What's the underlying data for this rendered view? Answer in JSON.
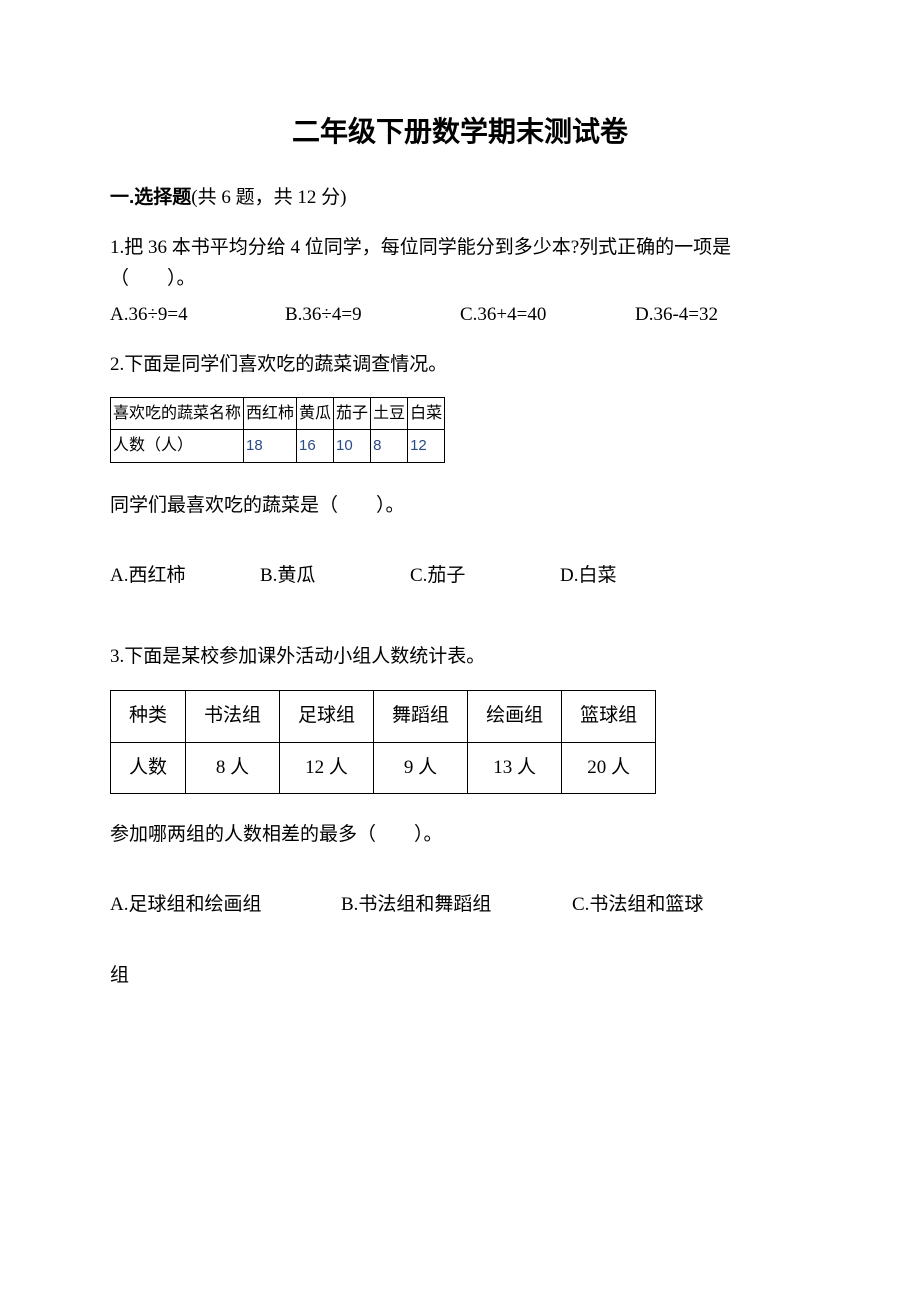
{
  "title": "二年级下册数学期末测试卷",
  "section1": {
    "number": "一.",
    "name": "选择题",
    "info": "(共 6 题，共 12 分)"
  },
  "q1": {
    "text": "1.把 36 本书平均分给 4 位同学，每位同学能分到多少本?列式正确的一项是（　　）。",
    "a": "A.36÷9=4",
    "b": "B.36÷4=9",
    "c": "C.36+4=40",
    "d": "D.36-4=32"
  },
  "q2": {
    "text": "2.下面是同学们喜欢吃的蔬菜调查情况。",
    "table_head": "喜欢吃的蔬菜名称",
    "col1": "西红柿",
    "col2": "黄瓜",
    "col3": "茄子",
    "col4": "土豆",
    "col5": "白菜",
    "row_label": "人数（人）",
    "v1": "18",
    "v2": "16",
    "v3": "10",
    "v4": "8",
    "v5": "12",
    "prompt": "同学们最喜欢吃的蔬菜是（　　）。",
    "a": "A.西红柿",
    "b": "B.黄瓜",
    "c": "C.茄子",
    "d": "D.白菜"
  },
  "q3": {
    "text": "3.下面是某校参加课外活动小组人数统计表。",
    "h1": "种类",
    "h2": "书法组",
    "h3": "足球组",
    "h4": "舞蹈组",
    "h5": "绘画组",
    "h6": "篮球组",
    "r1": "人数",
    "v1": "8 人",
    "v2": "12 人",
    "v3": "9 人",
    "v4": "13 人",
    "v5": "20 人",
    "prompt": "参加哪两组的人数相差的最多（　　）。",
    "a": "A.足球组和绘画组",
    "b": "B.书法组和舞蹈组",
    "c": "C.书法组和篮球",
    "trail": "组"
  }
}
